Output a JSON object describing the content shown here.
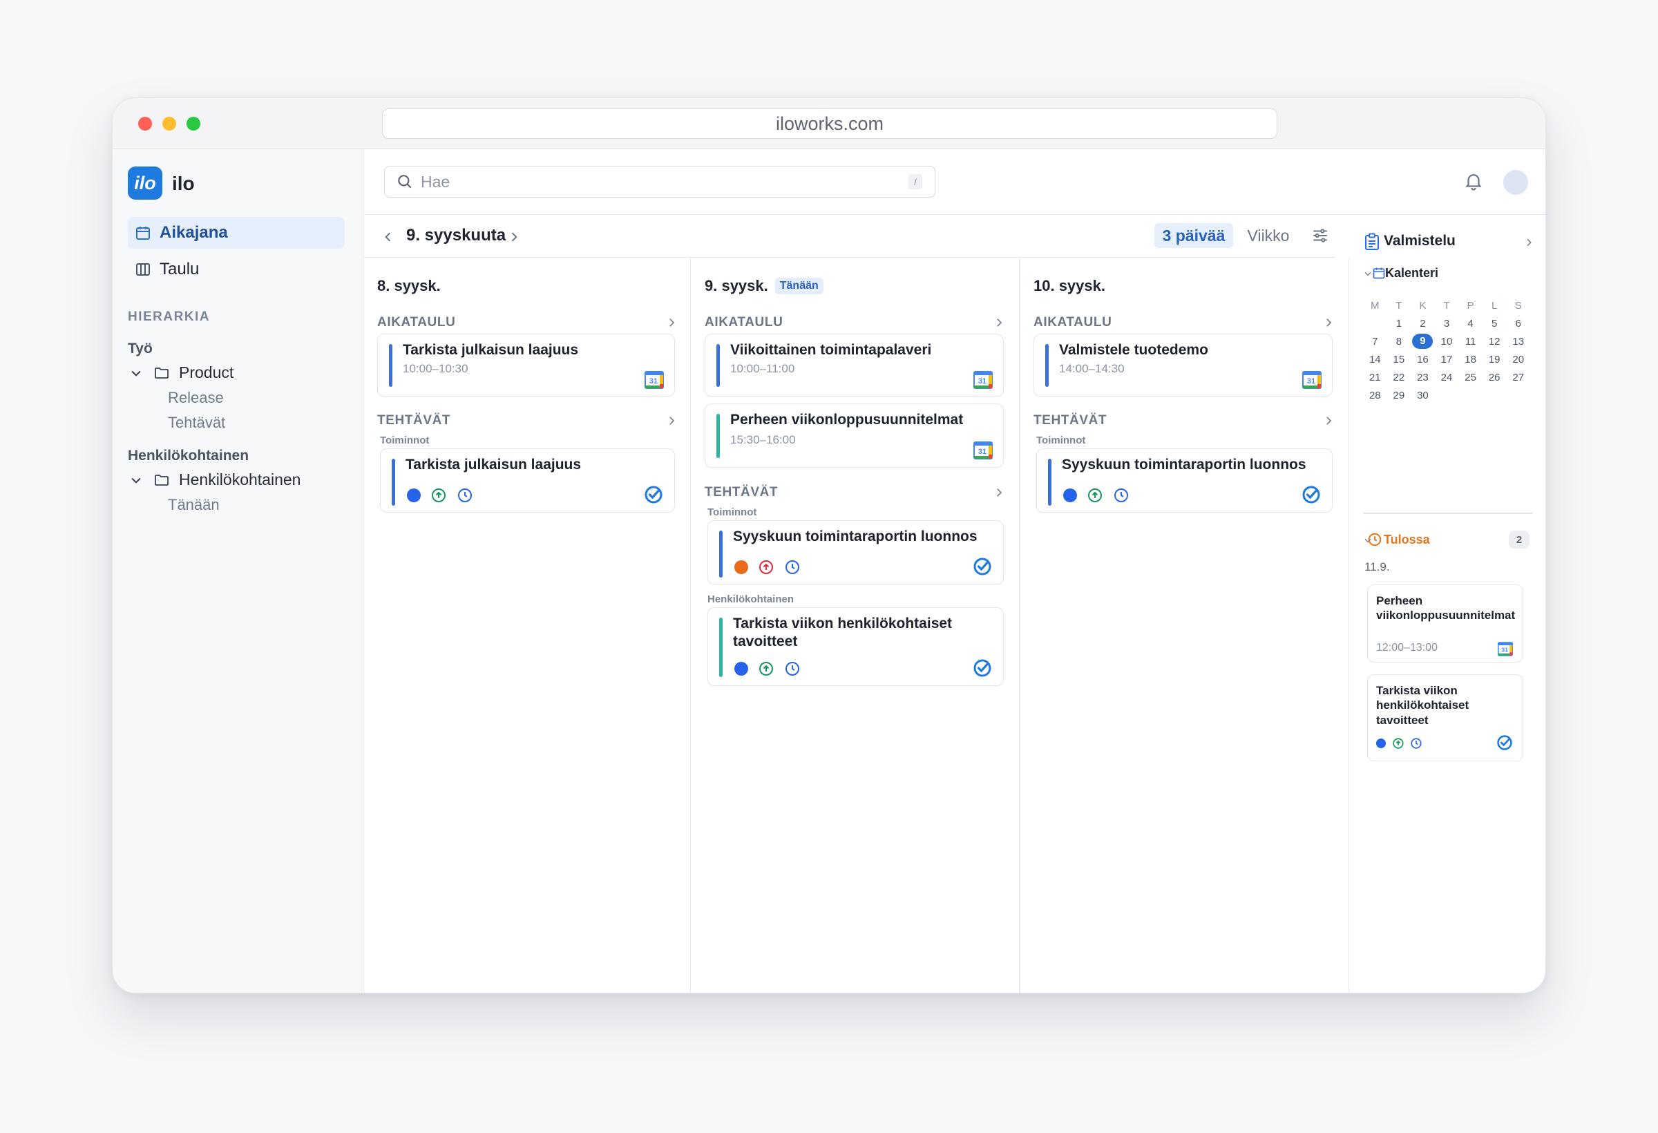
{
  "browser": {
    "url": "iloworks.com"
  },
  "app": {
    "logo_text": "ilo",
    "name": "ilo"
  },
  "sidebar": {
    "nav": [
      {
        "label": "Aikajana",
        "icon": "calendar-icon",
        "active": true
      },
      {
        "label": "Taulu",
        "icon": "columns-icon",
        "active": false
      }
    ],
    "section_label": "HIERARKIA",
    "groups": [
      {
        "label": "Työ",
        "folder": "Product",
        "children": [
          "Release",
          "Tehtävät"
        ]
      },
      {
        "label": "Henkilökohtainen",
        "folder": "Henkilökohtainen",
        "children": [
          "Tänään"
        ]
      }
    ]
  },
  "topbar": {
    "search_placeholder": "Hae",
    "search_shortcut": "/"
  },
  "datebar": {
    "current_date": "9. syyskuuta",
    "views": [
      {
        "label": "3 päivää",
        "active": true
      },
      {
        "label": "Viikko",
        "active": false
      }
    ]
  },
  "columns": [
    {
      "date": "8. syysk.",
      "today_badge": "",
      "schedule_label": "AIKATAULU",
      "events": [
        {
          "title": "Tarkista julkaisun laajuus",
          "time": "10:00–10:30",
          "color": "#3b6fd8"
        }
      ],
      "tasks_label": "TEHTÄVÄT",
      "task_groups": [
        {
          "label": "Toiminnot",
          "tasks": [
            {
              "title": "Tarkista julkaisun laajuus",
              "color": "#3b6fd8",
              "status_color": "#2563eb",
              "priority_color": "#15965a"
            }
          ]
        }
      ]
    },
    {
      "date": "9. syysk.",
      "today_badge": "Tänään",
      "schedule_label": "AIKATAULU",
      "events": [
        {
          "title": "Viikoittainen toimintapalaveri",
          "time": "10:00–11:00",
          "color": "#3b6fd8"
        },
        {
          "title": "Perheen viikonloppusuunnitelmat",
          "time": "15:30–16:00",
          "color": "#2fb3a4"
        }
      ],
      "tasks_label": "TEHTÄVÄT",
      "task_groups": [
        {
          "label": "Toiminnot",
          "tasks": [
            {
              "title": "Syyskuun toimintaraportin luonnos",
              "color": "#3b6fd8",
              "status_color": "#ea6a1c",
              "priority_color": "#dc2f36"
            }
          ]
        },
        {
          "label": "Henkilökohtainen",
          "tasks": [
            {
              "title": "Tarkista viikon henkilökohtaiset tavoitteet",
              "color": "#2fb3a4",
              "status_color": "#2563eb",
              "priority_color": "#15965a"
            }
          ]
        }
      ]
    },
    {
      "date": "10. syysk.",
      "today_badge": "",
      "schedule_label": "AIKATAULU",
      "events": [
        {
          "title": "Valmistele tuotedemo",
          "time": "14:00–14:30",
          "color": "#3b6fd8"
        }
      ],
      "tasks_label": "TEHTÄVÄT",
      "task_groups": [
        {
          "label": "Toiminnot",
          "tasks": [
            {
              "title": "Syyskuun toimintaraportin luonnos",
              "color": "#3b6fd8",
              "status_color": "#2563eb",
              "priority_color": "#15965a"
            }
          ]
        }
      ]
    }
  ],
  "right_panel": {
    "title": "Valmistelu",
    "calendar_label": "Kalenteri",
    "weekdays": [
      "M",
      "T",
      "K",
      "T",
      "P",
      "L",
      "S"
    ],
    "weeks": [
      [
        "",
        "1",
        "2",
        "3",
        "4",
        "5",
        "6"
      ],
      [
        "7",
        "8",
        "9",
        "10",
        "11",
        "12",
        "13"
      ],
      [
        "14",
        "15",
        "16",
        "17",
        "18",
        "19",
        "20"
      ],
      [
        "21",
        "22",
        "23",
        "24",
        "25",
        "26",
        "27"
      ],
      [
        "28",
        "29",
        "30",
        "",
        "",
        "",
        ""
      ]
    ],
    "selected_day": "9",
    "upcoming_label": "Tulossa",
    "upcoming_count": "2",
    "upcoming_date": "11.9.",
    "upcoming_items": [
      {
        "title": "Perheen viikonloppusuunnitelmat",
        "time": "12:00–13:00"
      },
      {
        "title": "Tarkista viikon henkilökohtaiset tavoitteet"
      }
    ]
  }
}
